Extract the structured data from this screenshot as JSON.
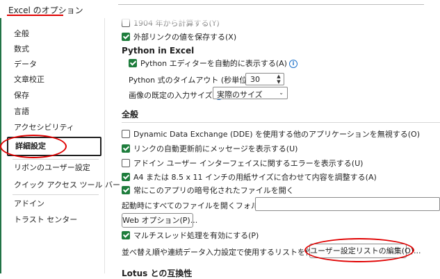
{
  "window": {
    "title": "Excel のオプション"
  },
  "sidebar": {
    "items": [
      {
        "label": "全般"
      },
      {
        "label": "数式"
      },
      {
        "label": "データ"
      },
      {
        "label": "文章校正"
      },
      {
        "label": "保存"
      },
      {
        "label": "言語"
      },
      {
        "label": "アクセシビリティ"
      },
      {
        "label": "詳細設定",
        "selected": true
      },
      {
        "label": "リボンのユーザー設定"
      },
      {
        "label": "クイック アクセス ツール バー"
      },
      {
        "label": "アドイン"
      },
      {
        "label": "トラスト センター"
      }
    ]
  },
  "content": {
    "partial_top": "1904 年から計算する(Y)",
    "save_external_links": {
      "label": "外部リンクの値を保存する(X)",
      "checked": true
    },
    "python_section": {
      "title": "Python in Excel",
      "show_editor": {
        "label": "Python エディターを自動的に表示する(A)",
        "checked": true
      },
      "timeout_label": "Python 式のタイムアウト (秒単位)(P)",
      "timeout_value": "30",
      "default_output_label": "画像の既定の入力サイズ",
      "default_output_value": "実際のサイズ"
    },
    "general_section": {
      "title": "全般",
      "options": [
        {
          "label": "Dynamic Data Exchange (DDE) を使用する他のアプリケーションを無視する(O)",
          "checked": false
        },
        {
          "label": "リンクの自動更新前にメッセージを表示する(U)",
          "checked": true
        },
        {
          "label": "アドイン ユーザー インターフェイスに関するエラーを表示する(U)",
          "checked": false
        },
        {
          "label": "A4 または 8.5 x 11 インチの用紙サイズに合わせて内容を調整する(A)",
          "checked": true
        },
        {
          "label": "常にこのアプリの暗号化されたファイルを開く",
          "checked": true
        }
      ],
      "startup_folder_label": "起動時にすべてのファイルを開くフォルダー(L):",
      "startup_folder_value": "",
      "web_options_button": "Web オプション(P)...",
      "multithread": {
        "label": "マルチスレッド処理を有効にする(P)",
        "checked": true
      },
      "custom_lists_label": "並べ替え順や連続データ入力設定で使用するリストを作成します:",
      "custom_lists_button": "ユーザー設定リストの編集(O)..."
    },
    "lotus_section": {
      "title": "Lotus との互換性"
    }
  },
  "colors": {
    "accent_green": "#1e7d3c",
    "annotation_red": "#e00000",
    "info_blue": "#1a6fc9"
  }
}
